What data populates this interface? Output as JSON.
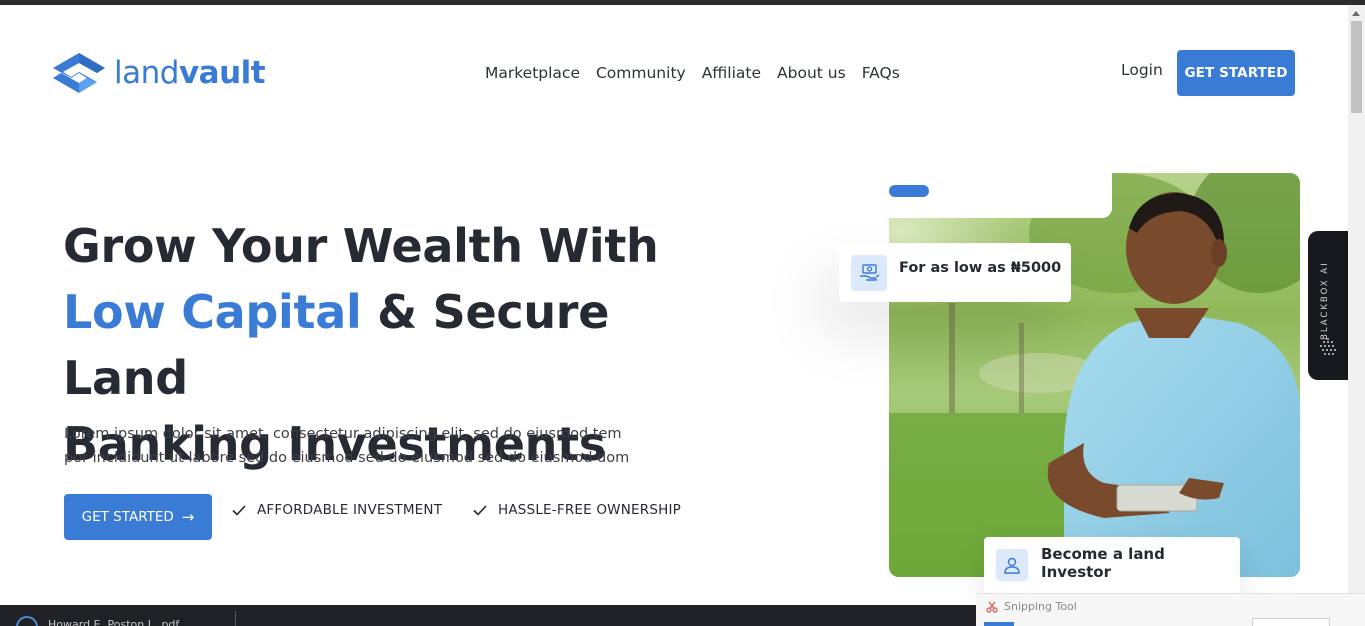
{
  "header": {
    "logo_text_light": "land",
    "logo_text_bold": "vault",
    "logo_icon": "landvault-logo-icon",
    "nav": [
      "Marketplace",
      "Community",
      "Affiliate",
      "About us",
      "FAQs"
    ],
    "login_label": "Login",
    "cta_label": "GET STARTED"
  },
  "hero": {
    "title_line1": "Grow Your Wealth With",
    "title_accent": "Low Capital",
    "title_line2_rest": " & Secure Land",
    "title_line3": "Banking Investments",
    "description_line1": "Lorem ipsum dolor sit amet, consectetur adipiscing elit, sed do eiusmod tem",
    "description_line2": "por incididunt ut labore sed do eiusmod sed do eiusmod sed do eiusmod dom",
    "cta_label": "GET STARTED",
    "cta_icon": "arrow-right-icon",
    "features": [
      "AFFORDABLE INVESTMENT",
      "HASSLE-FREE OWNERSHIP"
    ]
  },
  "cards": {
    "price": "For as low as ₦5000",
    "price_icon": "money-hand-icon",
    "investor": "Become a land Investor",
    "investor_icon": "user-icon"
  },
  "side_tab": {
    "label": "BLACKBOX AI"
  },
  "taskbar": {
    "file_label": "Howard E. Poston I...pdf",
    "snipping_label": "Snipping Tool"
  },
  "colors": {
    "accent": "#3a7bd5",
    "text": "#262b33",
    "icon_bg": "#dbe9fb"
  }
}
